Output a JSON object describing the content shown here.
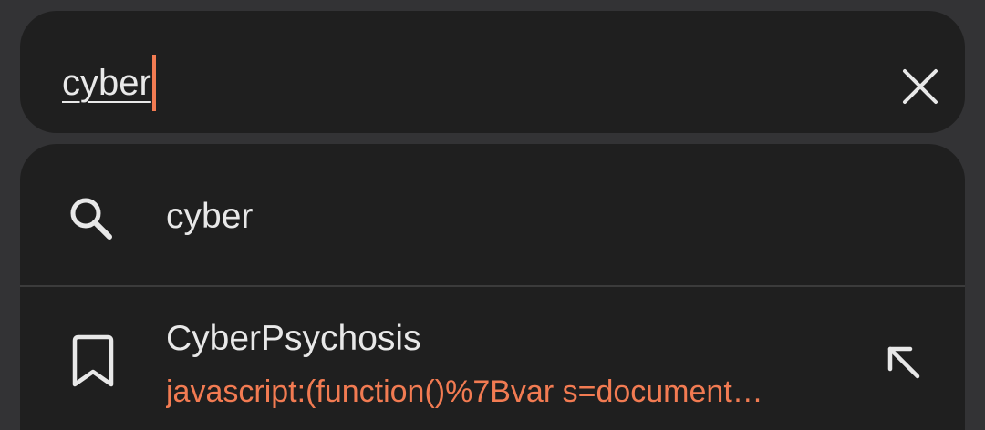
{
  "search": {
    "query": "cyber",
    "cursor_color": "#f27b52"
  },
  "suggestions": [
    {
      "type": "search",
      "icon": "search-icon",
      "text": "cyber"
    },
    {
      "type": "bookmark",
      "icon": "bookmark-icon",
      "title": "CyberPsychosis",
      "url": "javascript:(function()%7Bvar s=document…",
      "action_icon": "fill-arrow-icon"
    }
  ],
  "colors": {
    "background": "#333335",
    "surface": "#1f1f1f",
    "text": "#e8e8e8",
    "accent": "#f27b52"
  }
}
